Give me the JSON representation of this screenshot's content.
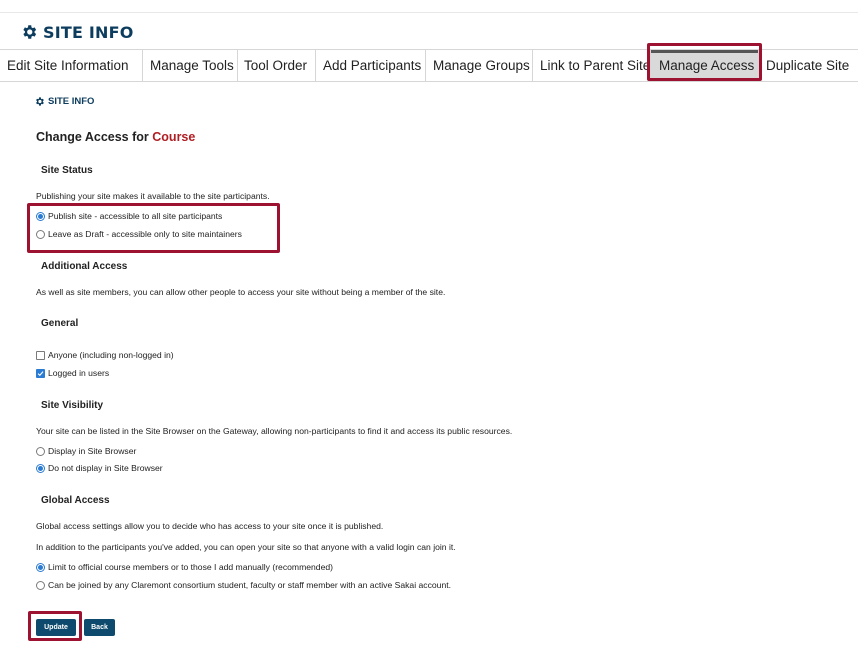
{
  "header": {
    "title": "SITE INFO",
    "icon": "gear-icon"
  },
  "tabs": [
    {
      "label": "Edit Site Information",
      "active": false
    },
    {
      "label": "Manage Tools",
      "active": false
    },
    {
      "label": "Tool Order",
      "active": false
    },
    {
      "label": "Add Participants",
      "active": false
    },
    {
      "label": "Manage Groups",
      "active": false
    },
    {
      "label": "Link to Parent Site",
      "active": false
    },
    {
      "label": "Manage Access",
      "active": true
    },
    {
      "label": "Duplicate Site",
      "active": false
    }
  ],
  "subheader": {
    "title": "SITE INFO"
  },
  "page": {
    "heading_prefix": "Change Access for",
    "heading_site": "Course"
  },
  "site_status": {
    "title": "Site Status",
    "description": "Publishing your site makes it available to the site participants.",
    "options": [
      {
        "label": "Publish site - accessible to all site participants",
        "selected": true
      },
      {
        "label": "Leave as Draft - accessible only to site maintainers",
        "selected": false
      }
    ]
  },
  "additional_access": {
    "title": "Additional Access",
    "description": "As well as site members, you can allow other people to access your site without being a member of the site."
  },
  "general": {
    "title": "General",
    "options": [
      {
        "label": "Anyone (including non-logged in)",
        "checked": false
      },
      {
        "label": "Logged in users",
        "checked": true
      }
    ]
  },
  "site_visibility": {
    "title": "Site Visibility",
    "description": "Your site can be listed in the Site Browser on the Gateway, allowing non-participants to find it and access its public resources.",
    "options": [
      {
        "label": "Display in Site Browser",
        "selected": false
      },
      {
        "label": "Do not display in Site Browser",
        "selected": true
      }
    ]
  },
  "global_access": {
    "title": "Global Access",
    "description1": "Global access settings allow you to decide who has access to your site once it is published.",
    "description2": "In addition to the participants you've added, you can open your site so that anyone with a valid login can join it.",
    "options": [
      {
        "label": "Limit to official course members or to those I add manually (recommended)",
        "selected": true
      },
      {
        "label": "Can be joined by any Claremont consortium student, faculty or staff member with an active Sakai account.",
        "selected": false
      }
    ]
  },
  "buttons": {
    "update": "Update",
    "back": "Back"
  },
  "colors": {
    "brand": "#0d3d5e",
    "highlight": "#9c1230",
    "course": "#b01e23",
    "radio_on": "#2a7bd4",
    "button": "#0d4a6d"
  }
}
